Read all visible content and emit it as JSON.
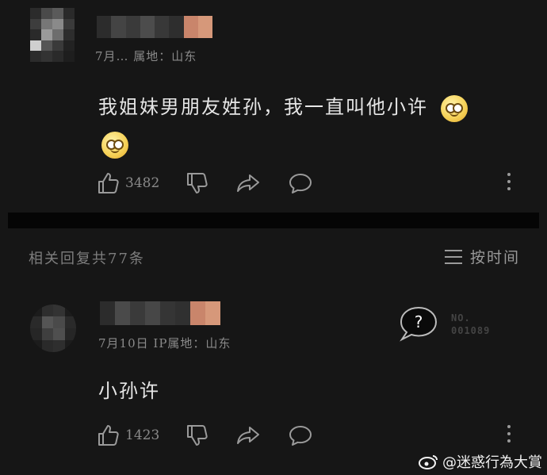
{
  "comments": [
    {
      "meta": "7月… 属地：山东",
      "text": "我姐妹男朋友姓孙，我一直叫他小许",
      "likes": "3482",
      "emoji_name": "smirk-emoji"
    },
    {
      "meta": "7月10日 IP属地：山东",
      "text": "小孙许",
      "likes": "1423"
    }
  ],
  "replies_header": "相关回复共77条",
  "sort_label": "按时间",
  "badge": {
    "question": "?",
    "no_line1": "NO.",
    "no_line2": "001089"
  },
  "watermark": "@迷惑行為大賞",
  "colors": {
    "background": "#161616",
    "divider": "#050505",
    "text": "#e6e6e6",
    "muted": "#8a8a8a"
  }
}
